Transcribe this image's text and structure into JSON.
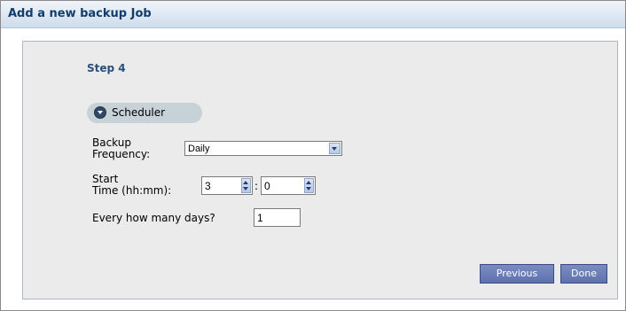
{
  "window": {
    "title": "Add a new backup Job"
  },
  "step": {
    "title": "Step 4"
  },
  "section": {
    "label": "Scheduler",
    "icon": "chevron-down-circle-icon"
  },
  "form": {
    "frequency": {
      "label_line1": "Backup",
      "label_line2": "Frequency:",
      "value": "Daily"
    },
    "start_time": {
      "label_line1": "Start",
      "label_line2": "Time (hh:mm):",
      "hours": "3",
      "separator": ":",
      "minutes": "0"
    },
    "every_days": {
      "label": "Every how many days?",
      "value": "1"
    }
  },
  "buttons": {
    "previous": "Previous",
    "done": "Done"
  },
  "colors": {
    "title_text": "#123d6b",
    "panel_bg": "#ebebeb",
    "button_bg": "#6c7eb8",
    "pill_bg": "#c6d1d8"
  }
}
